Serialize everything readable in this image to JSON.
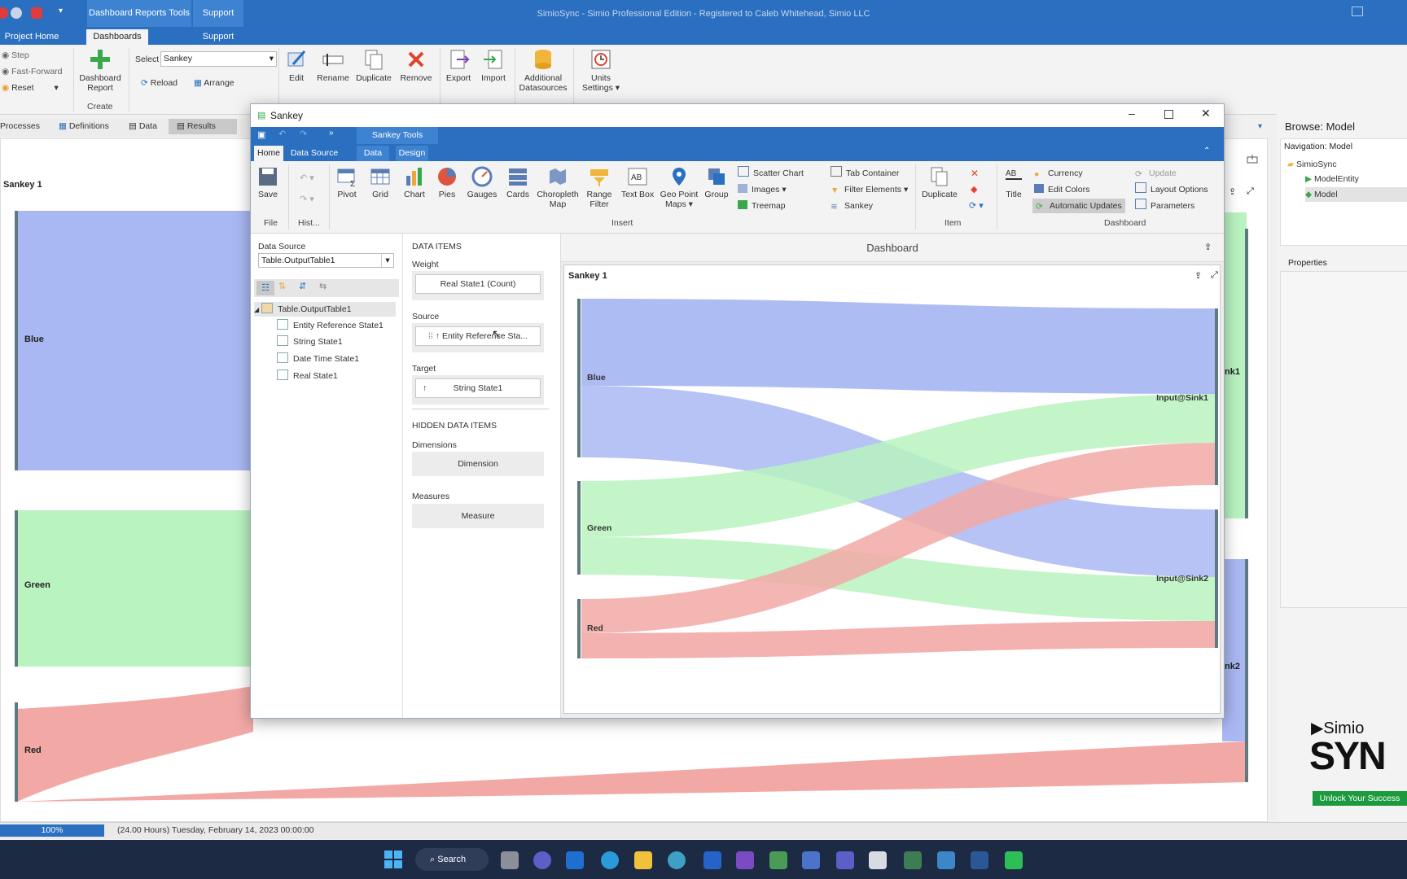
{
  "app": {
    "title": "SimioSync - Simio Professional Edition - Registered to Caleb Whitehead, Simio LLC",
    "context_tab_group": "Dashboard Reports Tools",
    "context_tab_support": "Support",
    "tabs": [
      "Project Home",
      "Dashboards",
      "Support"
    ]
  },
  "run_controls": {
    "step": "Step",
    "fast_forward": "Fast-Forward",
    "reset": "Reset"
  },
  "ribbon": {
    "dashboard_report": "Dashboard Report",
    "create": "Create",
    "select_label": "Select",
    "select_value": "Sankey",
    "reload": "Reload",
    "arrange": "Arrange",
    "edit": "Edit",
    "rename": "Rename",
    "duplicate": "Duplicate",
    "remove": "Remove",
    "export": "Export",
    "import": "Import",
    "additional_datasources": "Additional Datasources",
    "units_settings": "Units Settings"
  },
  "subtabs": [
    "Processes",
    "Definitions",
    "Data",
    "Results"
  ],
  "background_panel": {
    "title": "Sankey 1",
    "nodes": [
      "Blue",
      "Green",
      "Red"
    ],
    "right_node_fragments": [
      "nk1",
      "nk2"
    ]
  },
  "browse": {
    "title": "Browse: Model",
    "navigation_label": "Navigation: Model",
    "tree": [
      "SimioSync",
      "ModelEntity",
      "Model"
    ],
    "properties_label": "Properties"
  },
  "status": {
    "zoom": "100%",
    "info": "(24.00 Hours) Tuesday, February 14, 2023 00:00:00"
  },
  "taskbar": {
    "search": "Search"
  },
  "branding": {
    "simio": "Simio",
    "syn": "SYN",
    "tagline": "Unlock Your Success"
  },
  "dialog": {
    "title": "Sankey",
    "tools_label": "Sankey Tools",
    "tabs": [
      "Home",
      "Data Source",
      "Data",
      "Design"
    ],
    "ribbon": {
      "save": "Save",
      "file": "File",
      "history": "Hist...",
      "insert_items": [
        "Pivot",
        "Grid",
        "Chart",
        "Pies",
        "Gauges",
        "Cards",
        "Choropleth Map",
        "Range Filter",
        "Text Box",
        "Geo Point Maps",
        "Group"
      ],
      "insert_small": [
        "Scatter Chart",
        "Images",
        "Treemap",
        "Tab Container",
        "Filter Elements",
        "Sankey"
      ],
      "insert": "Insert",
      "duplicate": "Duplicate",
      "item": "Item",
      "title_btn": "Title",
      "dashboard_small": [
        "Currency",
        "Edit Colors",
        "Automatic Updates",
        "Update",
        "Layout Options",
        "Parameters"
      ],
      "dashboard": "Dashboard"
    },
    "data_source_label": "Data Source",
    "data_source_value": "Table.OutputTable1",
    "fields_root": "Table.OutputTable1",
    "fields": [
      "Entity Reference State1",
      "String State1",
      "Date Time State1",
      "Real State1"
    ],
    "data_items_header": "DATA ITEMS",
    "weight_label": "Weight",
    "weight_value": "Real State1 (Count)",
    "source_label": "Source",
    "source_value": "Entity Reference Sta...",
    "target_label": "Target",
    "target_value": "String State1",
    "hidden_header": "HIDDEN DATA ITEMS",
    "dimensions_label": "Dimensions",
    "dimension_value": "Dimension",
    "measures_label": "Measures",
    "measure_value": "Measure",
    "dashboard_title": "Dashboard",
    "sankey_title": "Sankey 1",
    "sankey_nodes_left": [
      "Blue",
      "Green",
      "Red"
    ],
    "sankey_nodes_right": [
      "Input@Sink1",
      "Input@Sink2"
    ]
  },
  "colors": {
    "blue": "#a9b8f2",
    "green": "#b9f3c0",
    "red": "#f2a9a6",
    "accent": "#2a6fc0"
  }
}
